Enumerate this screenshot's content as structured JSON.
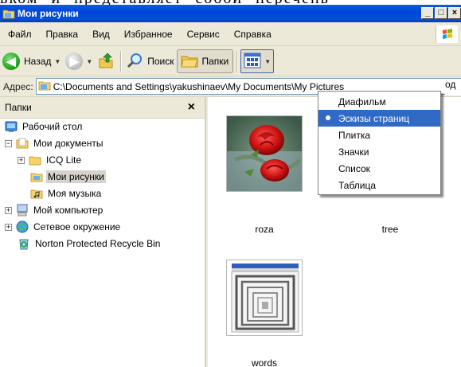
{
  "doc_text": [
    "вком",
    "и",
    "представляет",
    "собой",
    "перечень"
  ],
  "window": {
    "title": "Мои рисунки",
    "caption_buttons": [
      "_",
      "□",
      "×"
    ]
  },
  "menu": [
    "Файл",
    "Правка",
    "Вид",
    "Избранное",
    "Сервис",
    "Справка"
  ],
  "toolbar": {
    "back_label": "Назад",
    "search_label": "Поиск",
    "folders_label": "Папки"
  },
  "address": {
    "label": "Адрес:",
    "value": "C:\\Documents and Settings\\yakushinaev\\My Documents\\My Pictures",
    "go_partial": "од"
  },
  "folders_pane": {
    "title": "Папки",
    "close_label": "×",
    "nodes": [
      {
        "label": "Рабочий стол"
      },
      {
        "label": "Мои документы",
        "expander": "−"
      },
      {
        "label": "ICQ Lite",
        "expander": "+"
      },
      {
        "label": "Мои рисунки",
        "selected": true
      },
      {
        "label": "Моя музыка"
      },
      {
        "label": "Мой компьютер",
        "expander": "+"
      },
      {
        "label": "Сетевое окружение",
        "expander": "+"
      },
      {
        "label": "Norton Protected Recycle Bin"
      }
    ]
  },
  "thumbnails": [
    {
      "caption": "roza"
    },
    {
      "caption": "tree"
    },
    {
      "caption": "words"
    }
  ],
  "views_menu": {
    "items": [
      "Диафильм",
      "Эскизы страниц",
      "Плитка",
      "Значки",
      "Список",
      "Таблица"
    ],
    "selected_index": 1
  },
  "colors": {
    "titlebar": "#0054e3",
    "selection": "#316ac5",
    "window_bg": "#ece9d8"
  }
}
